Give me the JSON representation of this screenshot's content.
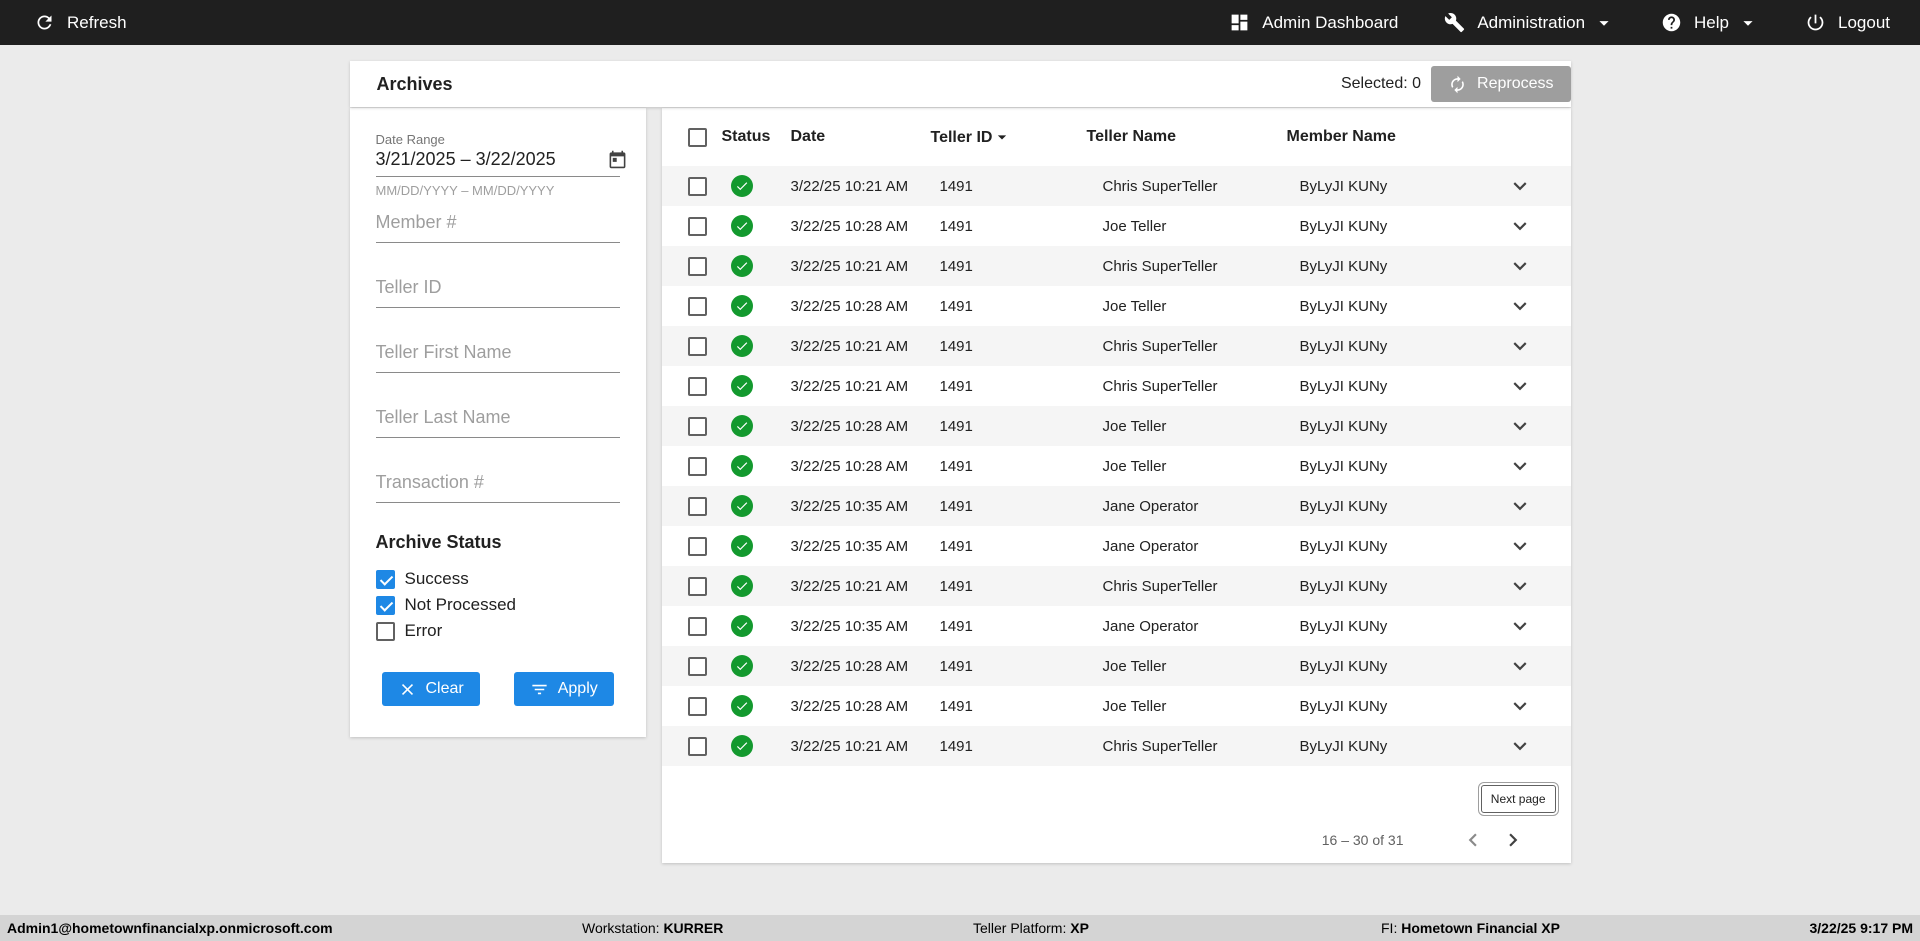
{
  "topbar": {
    "refresh_label": "Refresh",
    "admin_dashboard_label": "Admin Dashboard",
    "administration_label": "Administration",
    "help_label": "Help",
    "logout_label": "Logout"
  },
  "header": {
    "title": "Archives",
    "selected_label": "Selected: 0",
    "reprocess_label": "Reprocess"
  },
  "filters": {
    "date_range_label": "Date Range",
    "date_range_value": "3/21/2025 – 3/22/2025",
    "date_range_hint": "MM/DD/YYYY – MM/DD/YYYY",
    "member_placeholder": "Member #",
    "teller_id_placeholder": "Teller ID",
    "teller_first_placeholder": "Teller First Name",
    "teller_last_placeholder": "Teller Last Name",
    "transaction_placeholder": "Transaction #",
    "archive_status_label": "Archive Status",
    "statuses": [
      {
        "label": "Success",
        "checked": true
      },
      {
        "label": "Not Processed",
        "checked": true
      },
      {
        "label": "Error",
        "checked": false
      }
    ],
    "clear_label": "Clear",
    "apply_label": "Apply"
  },
  "table": {
    "headers": {
      "status": "Status",
      "date": "Date",
      "teller_id": "Teller ID",
      "teller_name": "Teller Name",
      "member_name": "Member Name"
    },
    "rows": [
      {
        "status": "success",
        "date": "3/22/25 10:21 AM",
        "teller_id": "1491",
        "teller_name": "Chris SuperTeller",
        "member_name": "ByLyJI KUNy"
      },
      {
        "status": "success",
        "date": "3/22/25 10:28 AM",
        "teller_id": "1491",
        "teller_name": "Joe Teller",
        "member_name": "ByLyJI KUNy"
      },
      {
        "status": "success",
        "date": "3/22/25 10:21 AM",
        "teller_id": "1491",
        "teller_name": "Chris SuperTeller",
        "member_name": "ByLyJI KUNy"
      },
      {
        "status": "success",
        "date": "3/22/25 10:28 AM",
        "teller_id": "1491",
        "teller_name": "Joe Teller",
        "member_name": "ByLyJI KUNy"
      },
      {
        "status": "success",
        "date": "3/22/25 10:21 AM",
        "teller_id": "1491",
        "teller_name": "Chris SuperTeller",
        "member_name": "ByLyJI KUNy"
      },
      {
        "status": "success",
        "date": "3/22/25 10:21 AM",
        "teller_id": "1491",
        "teller_name": "Chris SuperTeller",
        "member_name": "ByLyJI KUNy"
      },
      {
        "status": "success",
        "date": "3/22/25 10:28 AM",
        "teller_id": "1491",
        "teller_name": "Joe Teller",
        "member_name": "ByLyJI KUNy"
      },
      {
        "status": "success",
        "date": "3/22/25 10:28 AM",
        "teller_id": "1491",
        "teller_name": "Joe Teller",
        "member_name": "ByLyJI KUNy"
      },
      {
        "status": "success",
        "date": "3/22/25 10:35 AM",
        "teller_id": "1491",
        "teller_name": "Jane Operator",
        "member_name": "ByLyJI KUNy"
      },
      {
        "status": "success",
        "date": "3/22/25 10:35 AM",
        "teller_id": "1491",
        "teller_name": "Jane Operator",
        "member_name": "ByLyJI KUNy"
      },
      {
        "status": "success",
        "date": "3/22/25 10:21 AM",
        "teller_id": "1491",
        "teller_name": "Chris SuperTeller",
        "member_name": "ByLyJI KUNy"
      },
      {
        "status": "success",
        "date": "3/22/25 10:35 AM",
        "teller_id": "1491",
        "teller_name": "Jane Operator",
        "member_name": "ByLyJI KUNy"
      },
      {
        "status": "success",
        "date": "3/22/25 10:28 AM",
        "teller_id": "1491",
        "teller_name": "Joe Teller",
        "member_name": "ByLyJI KUNy"
      },
      {
        "status": "success",
        "date": "3/22/25 10:28 AM",
        "teller_id": "1491",
        "teller_name": "Joe Teller",
        "member_name": "ByLyJI KUNy"
      },
      {
        "status": "success",
        "date": "3/22/25 10:21 AM",
        "teller_id": "1491",
        "teller_name": "Chris SuperTeller",
        "member_name": "ByLyJI KUNy"
      }
    ]
  },
  "pagination": {
    "next_page_label": "Next page",
    "range_label": "16 – 30 of 31"
  },
  "statusbar": {
    "user": "Admin1@hometownfinancialxp.onmicrosoft.com",
    "workstation_label": "Workstation: ",
    "workstation_value": "KURRER",
    "platform_label": "Teller Platform: ",
    "platform_value": "XP",
    "fi_label": "FI: ",
    "fi_value": "Hometown Financial XP",
    "datetime": "3/22/25 9:17 PM"
  },
  "colors": {
    "accent_blue": "#1e88e5",
    "success_green": "#13992e",
    "disabled_gray": "#9e9e9e",
    "topbar_bg": "#1f1f1f"
  }
}
